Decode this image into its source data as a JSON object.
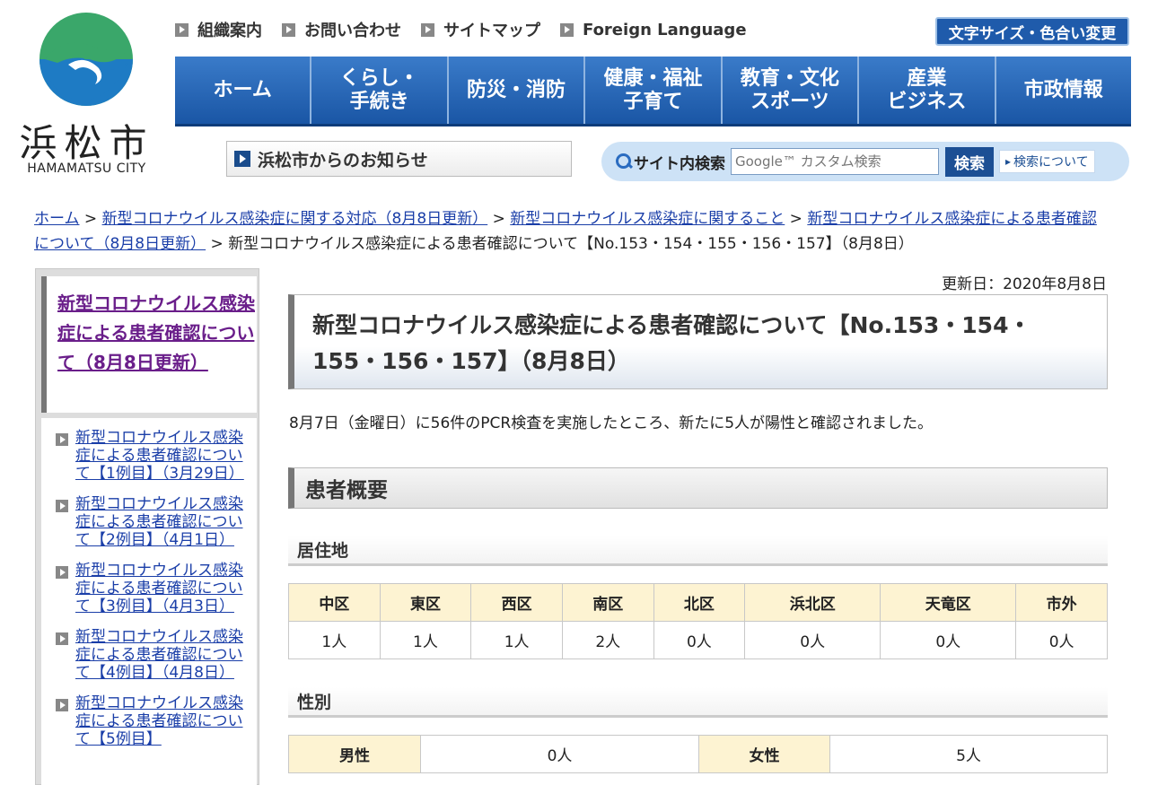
{
  "logo": {
    "name": "浜松市",
    "sub": "HAMAMATSU CITY"
  },
  "toplinks": [
    "組織案内",
    "お問い合わせ",
    "サイトマップ",
    "Foreign Language"
  ],
  "size_button": "文字サイズ・色合い変更",
  "nav": [
    {
      "line1": "ホーム",
      "line2": ""
    },
    {
      "line1": "くらし・",
      "line2": "手続き"
    },
    {
      "line1": "防災・消防",
      "line2": ""
    },
    {
      "line1": "健康・福祉",
      "line2": "子育て"
    },
    {
      "line1": "教育・文化",
      "line2": "スポーツ"
    },
    {
      "line1": "産業",
      "line2": "ビジネス"
    },
    {
      "line1": "市政情報",
      "line2": ""
    }
  ],
  "notice": "浜松市からのお知らせ",
  "search": {
    "label": "サイト内検索",
    "placeholder": "Google™ カスタム検索",
    "button": "検索",
    "help": "検索について"
  },
  "breadcrumb": {
    "links": [
      "ホーム",
      "新型コロナウイルス感染症に関する対応（8月8日更新）",
      "新型コロナウイルス感染症に関すること",
      "新型コロナウイルス感染症による患者確認について（8月8日更新）"
    ],
    "current": "新型コロナウイルス感染症による患者確認について【No.153・154・155・156・157】（8月8日）",
    "sep": " > "
  },
  "sidebar": {
    "heading": "新型コロナウイルス感染症による患者確認について（8月8日更新）",
    "items": [
      "新型コロナウイルス感染症による患者確認について【1例目】（3月29日）",
      "新型コロナウイルス感染症による患者確認について【2例目】（4月1日）",
      "新型コロナウイルス感染症による患者確認について【3例目】（4月3日）",
      "新型コロナウイルス感染症による患者確認について【4例目】（4月8日）",
      "新型コロナウイルス感染症による患者確認について【5例目】"
    ]
  },
  "main": {
    "updated": "更新日：2020年8月8日",
    "title_line1": "新型コロナウイルス感染症による患者確認について【No.153・154・",
    "title_line2": "155・156・157】（8月8日）",
    "lead": "8月7日（金曜日）に56件のPCR検査を実施したところ、新たに5人が陽性と確認されました。",
    "section": "患者概要",
    "residence": {
      "heading": "居住地",
      "headers": [
        "中区",
        "東区",
        "西区",
        "南区",
        "北区",
        "浜北区",
        "天竜区",
        "市外"
      ],
      "values": [
        "1人",
        "1人",
        "1人",
        "2人",
        "0人",
        "0人",
        "0人",
        "0人"
      ]
    },
    "gender": {
      "heading": "性別",
      "male_label": "男性",
      "male_value": "0人",
      "female_label": "女性",
      "female_value": "5人"
    }
  }
}
